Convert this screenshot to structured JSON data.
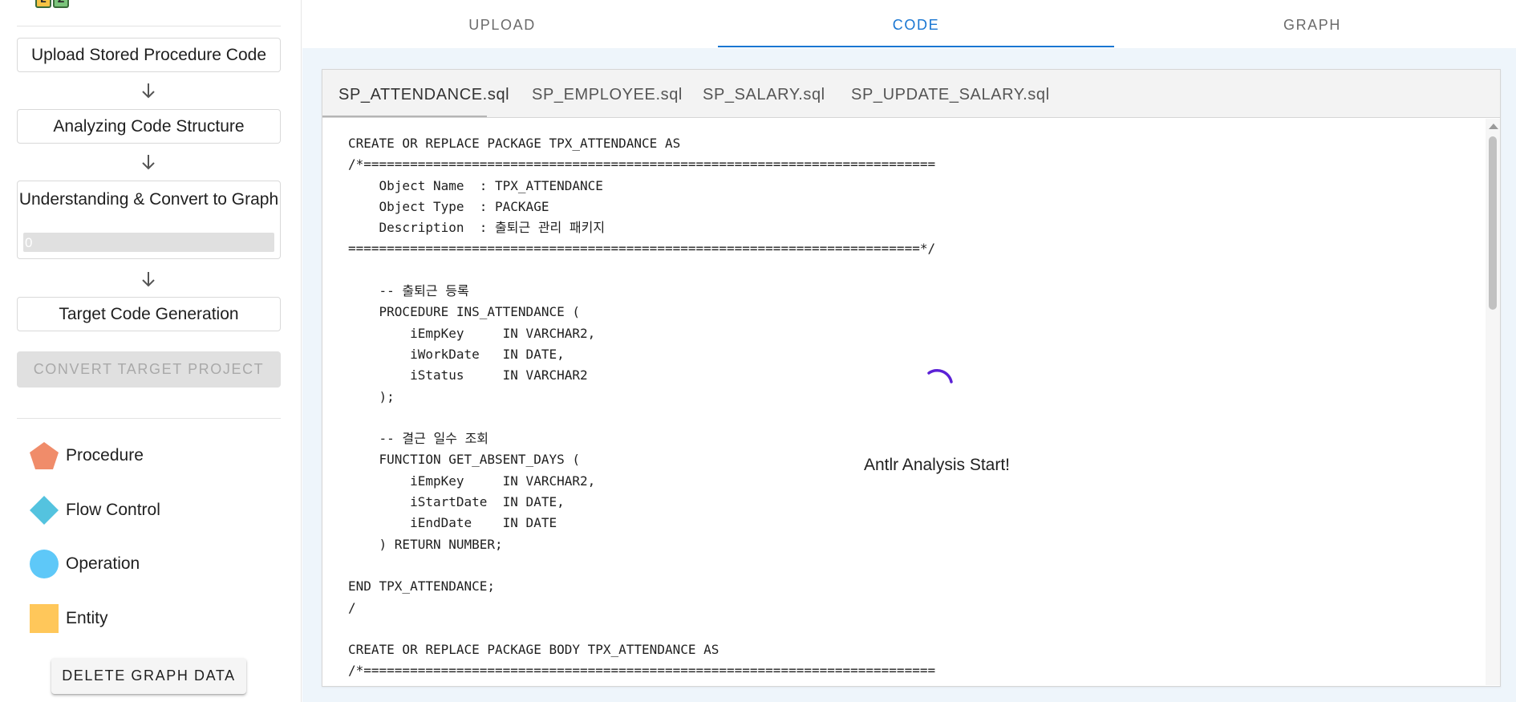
{
  "sidebar": {
    "logo": {
      "letters": [
        "E",
        "Z"
      ]
    },
    "steps": [
      {
        "label": "Upload Stored Procedure Code"
      },
      {
        "label": "Analyzing Code Structure"
      },
      {
        "label": "Understanding & Convert to Graph",
        "progress_text": "0",
        "progress": 0
      },
      {
        "label": "Target Code Generation"
      }
    ],
    "arrow_icon": "arrow-down-icon",
    "convert_button": "CONVERT TARGET PROJECT",
    "legend": [
      {
        "label": "Procedure",
        "shape": "pentagon",
        "color": "#f08c6a"
      },
      {
        "label": "Flow Control",
        "shape": "diamond",
        "color": "#54c3df"
      },
      {
        "label": "Operation",
        "shape": "circle",
        "color": "#5ec8f8"
      },
      {
        "label": "Entity",
        "shape": "square",
        "color": "#ffc75a"
      }
    ],
    "delete_button": "DELETE GRAPH DATA"
  },
  "main": {
    "tabs": [
      {
        "label": "UPLOAD"
      },
      {
        "label": "CODE",
        "active": true
      },
      {
        "label": "GRAPH"
      }
    ],
    "accent_color": "#1976d2",
    "files": [
      {
        "label": "SP_ATTENDANCE.sql",
        "active": true
      },
      {
        "label": "SP_EMPLOYEE.sql"
      },
      {
        "label": "SP_SALARY.sql"
      },
      {
        "label": "SP_UPDATE_SALARY.sql"
      }
    ],
    "code": "CREATE OR REPLACE PACKAGE TPX_ATTENDANCE AS\n/*==========================================================================\n    Object Name  : TPX_ATTENDANCE\n    Object Type  : PACKAGE\n    Description  : 출퇴근 관리 패키지\n==========================================================================*/\n\n    -- 출퇴근 등록\n    PROCEDURE INS_ATTENDANCE (\n        iEmpKey     IN VARCHAR2,\n        iWorkDate   IN DATE,\n        iStatus     IN VARCHAR2\n    );\n\n    -- 결근 일수 조회\n    FUNCTION GET_ABSENT_DAYS (\n        iEmpKey     IN VARCHAR2,\n        iStartDate  IN DATE,\n        iEndDate    IN DATE\n    ) RETURN NUMBER;\n\nEND TPX_ATTENDANCE;\n/\n\nCREATE OR REPLACE PACKAGE BODY TPX_ATTENDANCE AS\n/*==========================================================================",
    "loading": {
      "spinner_icon": "loading-spinner-icon",
      "spinner_color": "#5b21d6",
      "text": "Antlr Analysis Start!"
    }
  }
}
